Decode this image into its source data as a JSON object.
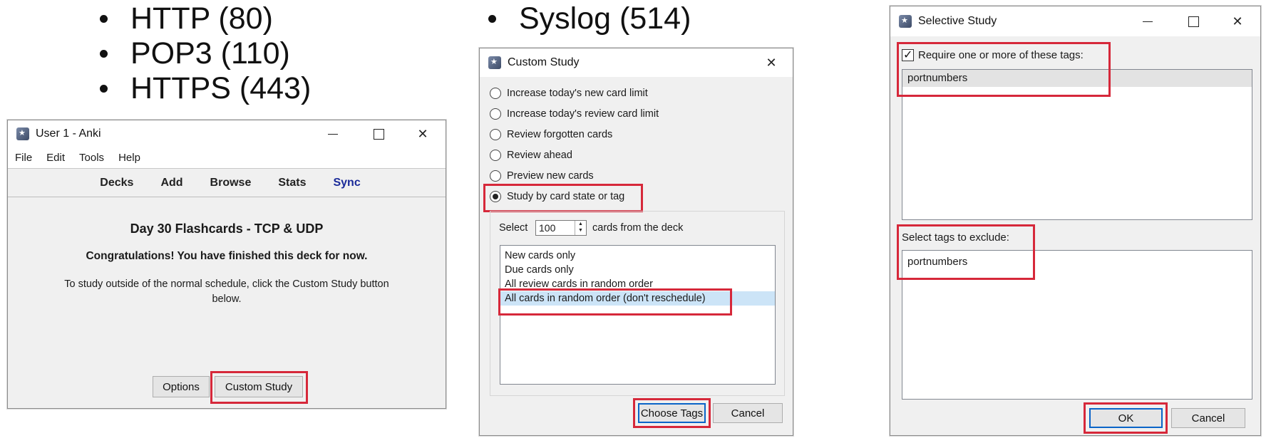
{
  "slide": {
    "bullets_left": [
      "HTTP (80)",
      "POP3 (110)",
      "HTTPS (443)"
    ],
    "bullets_mid": [
      "Syslog (514)"
    ]
  },
  "anki_window": {
    "title": "User 1 - Anki",
    "menu": [
      "File",
      "Edit",
      "Tools",
      "Help"
    ],
    "toolbar": [
      "Decks",
      "Add",
      "Browse",
      "Stats",
      "Sync"
    ],
    "deck_title": "Day 30 Flashcards - TCP & UDP",
    "congrats": "Congratulations! You have finished this deck for now.",
    "info_line1": "To study outside of the normal schedule, click the Custom Study button",
    "info_line2": "below.",
    "options_label": "Options",
    "custom_study_label": "Custom Study"
  },
  "custom_study_dialog": {
    "title": "Custom Study",
    "options": [
      {
        "label": "Increase today's new card limit",
        "selected": false
      },
      {
        "label": "Increase today's review card limit",
        "selected": false
      },
      {
        "label": "Review forgotten cards",
        "selected": false
      },
      {
        "label": "Review ahead",
        "selected": false
      },
      {
        "label": "Preview new cards",
        "selected": false
      },
      {
        "label": "Study by card state or tag",
        "selected": true
      }
    ],
    "select_label": "Select",
    "count_value": "100",
    "cards_from_label": "cards from the deck",
    "card_types": [
      "New cards only",
      "Due cards only",
      "All review cards in random order",
      "All cards in random order (don't reschedule)"
    ],
    "selected_card_type_index": 3,
    "choose_tags_label": "Choose Tags",
    "cancel_label": "Cancel"
  },
  "selective_study_dialog": {
    "title": "Selective Study",
    "require_label": "Require one or more of these tags:",
    "require_checked": true,
    "require_tags": [
      "portnumbers"
    ],
    "exclude_label": "Select tags to exclude:",
    "exclude_tags": [
      "portnumbers"
    ],
    "ok_label": "OK",
    "cancel_label": "Cancel"
  },
  "colors": {
    "highlight_box": "#d6283a",
    "sync_link": "#1a2a99",
    "selection": "#cce4f7",
    "focus_border": "#0a64c8"
  }
}
